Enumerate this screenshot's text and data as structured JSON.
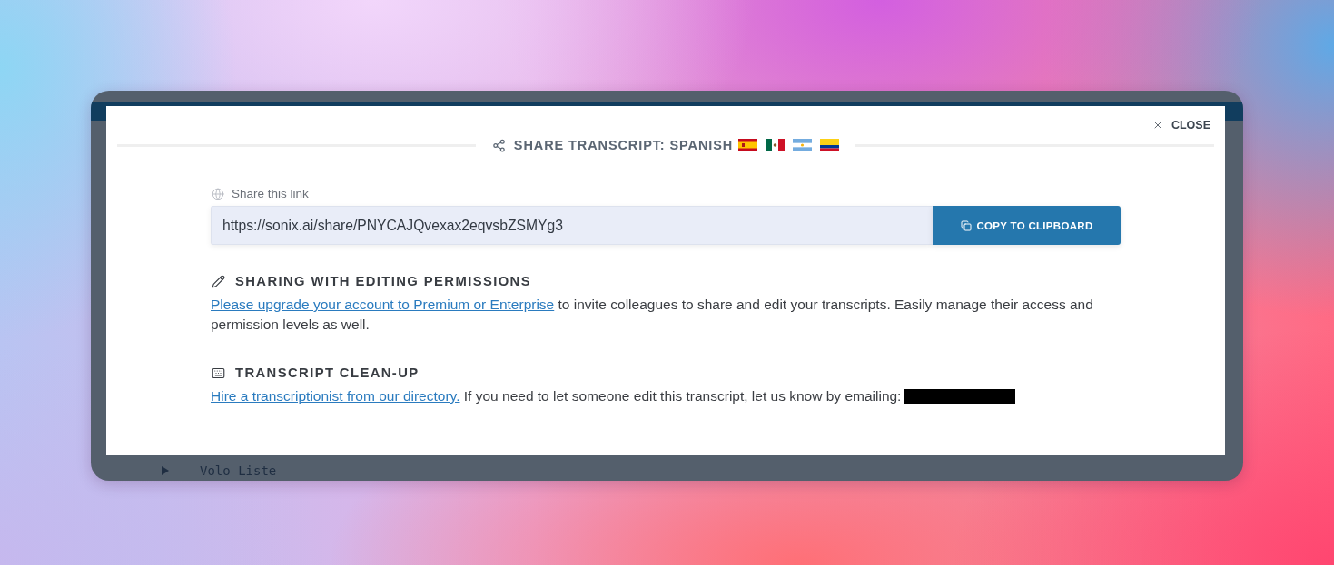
{
  "backdrop": {
    "list_row": {
      "label": "Volo Liste"
    }
  },
  "dialog": {
    "close_button": {
      "label": "CLOSE"
    },
    "title": "SHARE TRANSCRIPT: SPANISH",
    "flags": [
      {
        "kind": "es"
      },
      {
        "kind": "mx"
      },
      {
        "kind": "ar"
      },
      {
        "kind": "co"
      }
    ],
    "share_link": {
      "label": "Share this link",
      "value": "https://sonix.ai/share/PNYCAJQvexax2eqvsbZSMYg3",
      "button": "COPY TO CLIPBOARD"
    },
    "sections": [
      {
        "kind": "permissions",
        "heading": "SHARING WITH EDITING PERMISSIONS",
        "link": "Please upgrade your account to Premium or Enterprise",
        "text": "to invite colleagues to share and edit your transcripts. Easily manage their access and permission levels as well."
      },
      {
        "kind": "cleanup",
        "heading": "TRANSCRIPT CLEAN-UP",
        "link": "Hire a transcriptionist from our directory.",
        "text": "If you need to let someone edit this transcript, let us know by emailing:",
        "redacted": true
      }
    ]
  }
}
